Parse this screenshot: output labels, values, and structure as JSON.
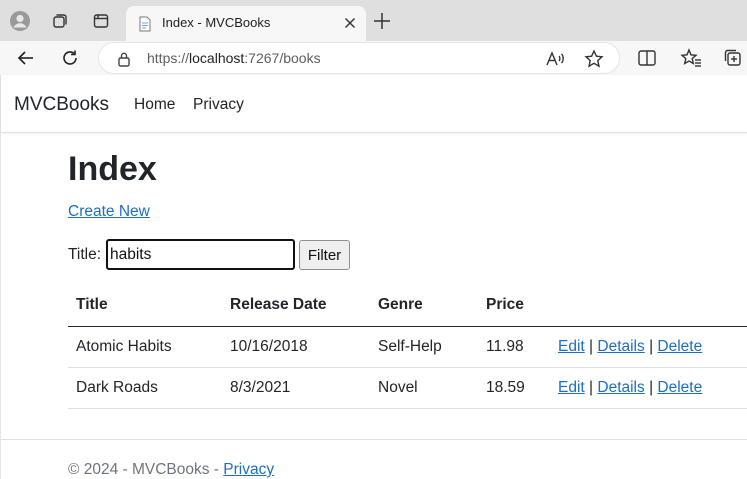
{
  "browser": {
    "tab_title": "Index - MVCBooks",
    "url_prefix": "https://",
    "url_host": "localhost",
    "url_rest": ":7267/books"
  },
  "site": {
    "brand": "MVCBooks",
    "nav": [
      "Home",
      "Privacy"
    ]
  },
  "main": {
    "heading": "Index",
    "create_link": "Create New",
    "filter": {
      "label": "Title:",
      "value": "habits",
      "button": "Filter"
    },
    "table": {
      "headers": [
        "Title",
        "Release Date",
        "Genre",
        "Price"
      ],
      "rows": [
        {
          "title": "Atomic Habits",
          "release_date": "10/16/2018",
          "genre": "Self-Help",
          "price": "11.98"
        },
        {
          "title": "Dark Roads",
          "release_date": "8/3/2021",
          "genre": "Novel",
          "price": "18.59"
        }
      ],
      "actions": {
        "edit": "Edit",
        "details": "Details",
        "delete": "Delete",
        "separator": "|"
      }
    }
  },
  "footer": {
    "text": "© 2024 - MVCBooks - ",
    "privacy_link": "Privacy"
  },
  "colors": {
    "link": "#1b6ec2",
    "text": "#212529",
    "muted": "#6c757d"
  }
}
